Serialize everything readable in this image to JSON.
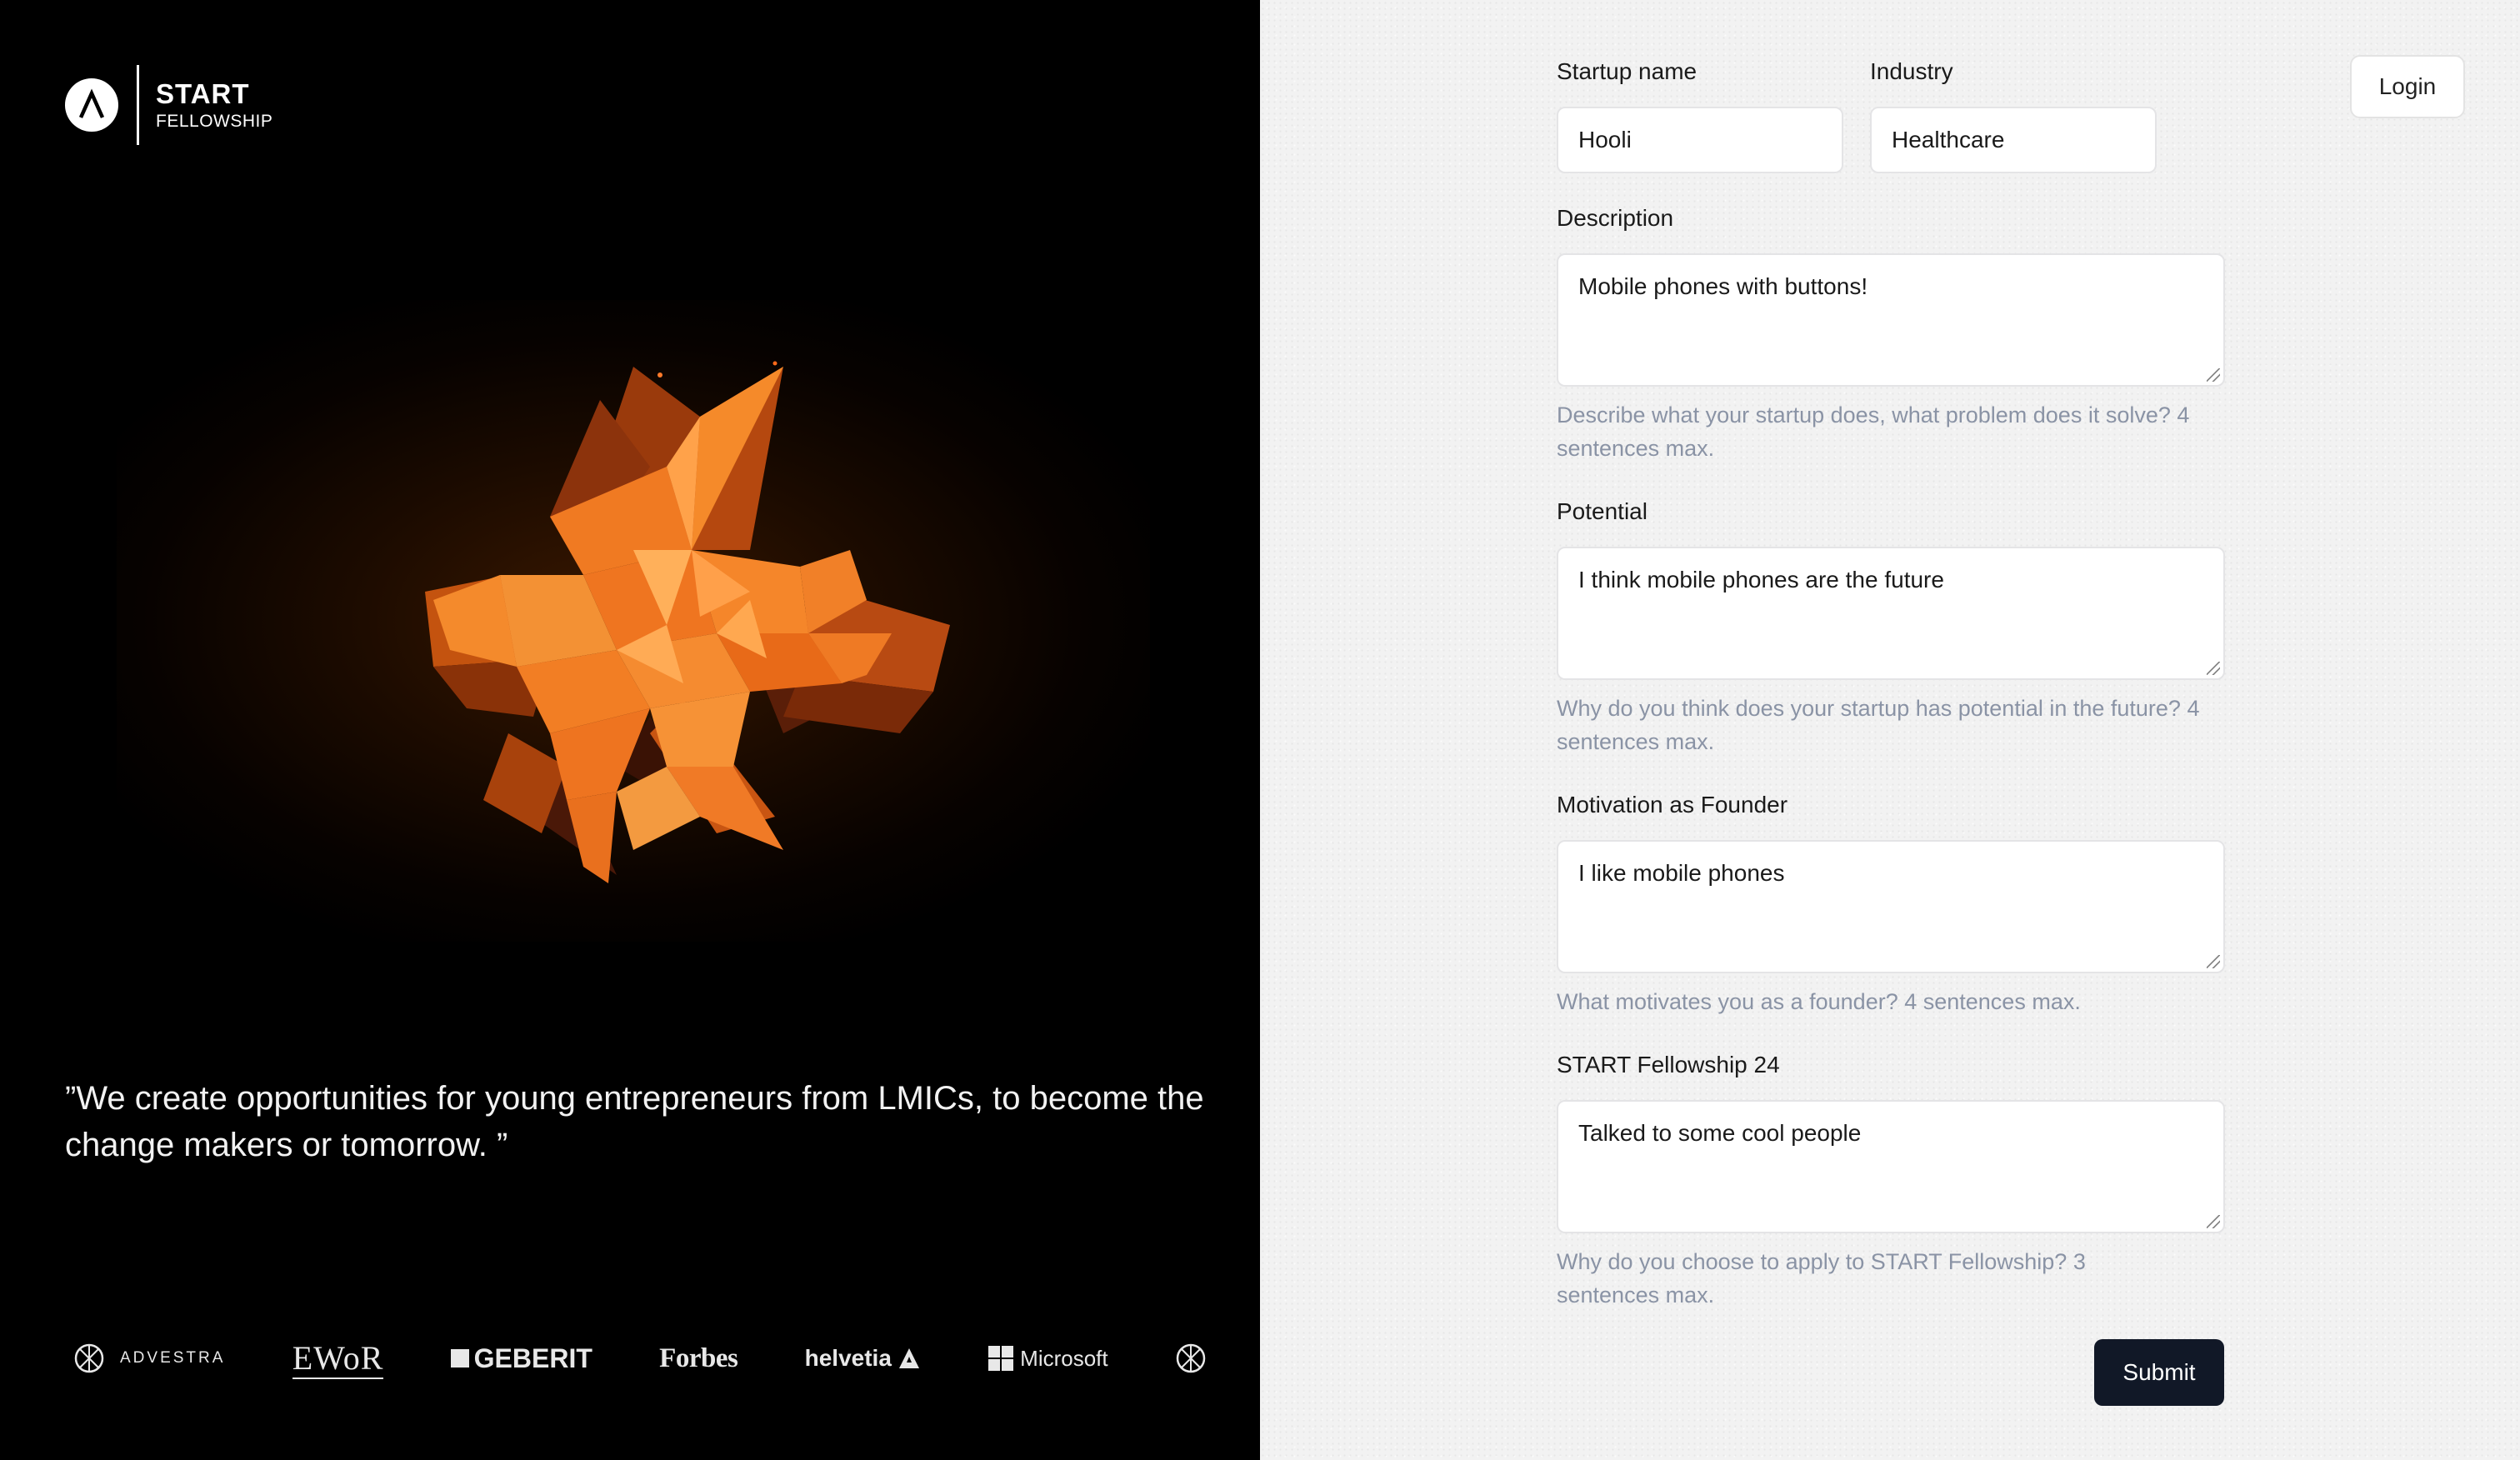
{
  "brand": {
    "title": "START",
    "subtitle": "FELLOWSHIP"
  },
  "quote": "”We create opportunities for young entrepreneurs from LMICs, to become the change makers or tomorrow. ”",
  "partners": {
    "advestra": "ADVESTRA",
    "ewor": "EWoR",
    "geberit": "GEBERIT",
    "forbes": "Forbes",
    "helvetia": "helvetia",
    "microsoft": "Microsoft"
  },
  "header": {
    "login_label": "Login"
  },
  "form": {
    "startup_name": {
      "label": "Startup name",
      "value": "Hooli"
    },
    "industry": {
      "label": "Industry",
      "value": "Healthcare"
    },
    "description": {
      "label": "Description",
      "value": "Mobile phones with buttons!",
      "hint": "Describe what your startup does, what problem does it solve? 4 sentences max."
    },
    "potential": {
      "label": "Potential",
      "value": "I think mobile phones are the future",
      "hint": "Why do you think does your startup has potential in the future? 4 sentences max."
    },
    "motivation": {
      "label": "Motivation as Founder",
      "value": "I like mobile phones",
      "hint": "What motivates you as a founder? 4 sentences max."
    },
    "fellowship": {
      "label": "START Fellowship 24",
      "value": "Talked to some cool people",
      "hint": "Why do you choose to apply to START Fellowship? 3 sentences max."
    },
    "submit_label": "Submit"
  },
  "colors": {
    "left_bg": "#000000",
    "right_bg": "#f2f2f2",
    "hint_text": "#8a93a5",
    "submit_bg": "#111827",
    "hero_orange": "#f07a22"
  }
}
